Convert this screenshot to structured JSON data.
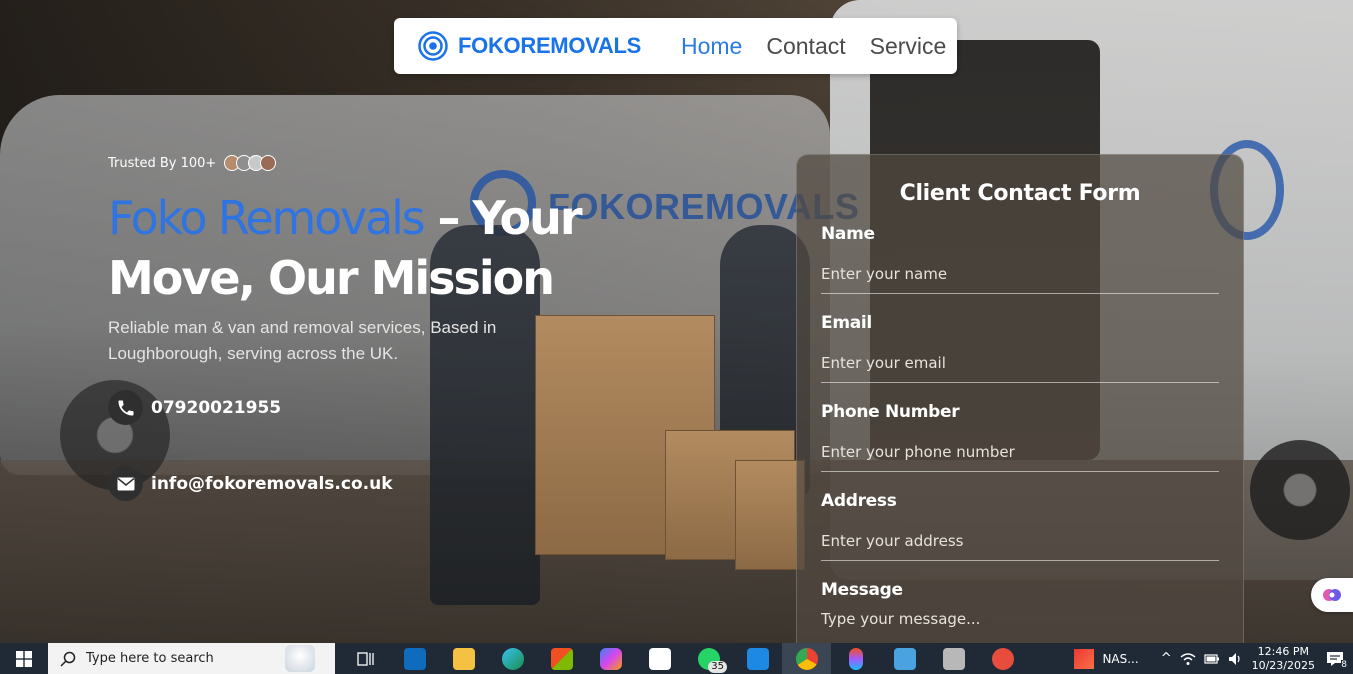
{
  "navbar": {
    "brand": "FOKOREMOVALS",
    "links": [
      {
        "label": "Home",
        "active": true
      },
      {
        "label": "Contact",
        "active": false
      },
      {
        "label": "Service",
        "active": false
      }
    ],
    "accent_color": "#1a73e8"
  },
  "hero": {
    "trusted_label": "Trusted By 100+",
    "headline_accent": "Foko Removals",
    "headline_rest": " – Your Move, Our Mission",
    "subtitle": "Reliable man & van and removal services, Based in Loughborough, serving across the UK.",
    "phone": "07920021955",
    "email": "info@fokoremovals.co.uk",
    "van_branding": "FOKOREMOVALS"
  },
  "form": {
    "title": "Client Contact Form",
    "fields": [
      {
        "label": "Name",
        "placeholder": "Enter your name"
      },
      {
        "label": "Email",
        "placeholder": "Enter your email"
      },
      {
        "label": "Phone Number",
        "placeholder": "Enter your phone number"
      },
      {
        "label": "Address",
        "placeholder": "Enter your address"
      },
      {
        "label": "Message",
        "placeholder": "Type your message..."
      }
    ]
  },
  "taskbar": {
    "search_placeholder": "Type here to search",
    "whatsapp_badge": "35",
    "tray_app_label": "NAS...",
    "time": "12:46 PM",
    "date": "10/23/2025",
    "notification_count": "8",
    "icons": [
      "task-view-icon",
      "outlook-icon",
      "file-explorer-icon",
      "edge-icon",
      "store-icon",
      "copilot-icon",
      "app-icon",
      "whatsapp-icon",
      "vscode-icon",
      "chrome-icon",
      "figma-icon",
      "control-panel-icon",
      "package-icon",
      "snipping-tool-icon"
    ]
  }
}
